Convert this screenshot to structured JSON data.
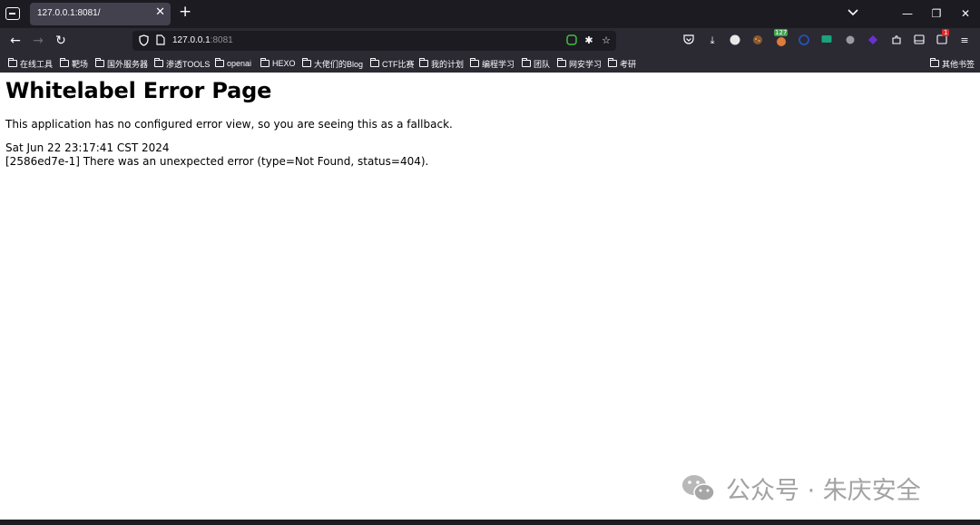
{
  "browser": {
    "tab": {
      "title": "127.0.0.1:8081/"
    },
    "url": {
      "host": "127.0.0.1",
      "port": ":8081"
    },
    "extension_badges": {
      "badge_127": "127",
      "badge_1": "1"
    },
    "bookmarks": [
      "在线工具",
      "靶场",
      "国外服务器",
      "渗透TOOLS",
      "openai",
      "HEXO",
      "大佬们的Blog",
      "CTF比赛",
      "我的计划",
      "编程学习",
      "团队",
      "网安学习",
      "考研"
    ],
    "other_bookmarks": "其他书签"
  },
  "page": {
    "title": "Whitelabel Error Page",
    "description": "This application has no configured error view, so you are seeing this as a fallback.",
    "timestamp": "Sat Jun 22 23:17:41 CST 2024",
    "error": "[2586ed7e-1] There was an unexpected error (type=Not Found, status=404)."
  },
  "watermark": {
    "text": "公众号 · 朱庆安全"
  },
  "colors": {
    "chrome_dark": "#1c1b22",
    "toolbar": "#2b2a33",
    "tab_active": "#42414d"
  }
}
